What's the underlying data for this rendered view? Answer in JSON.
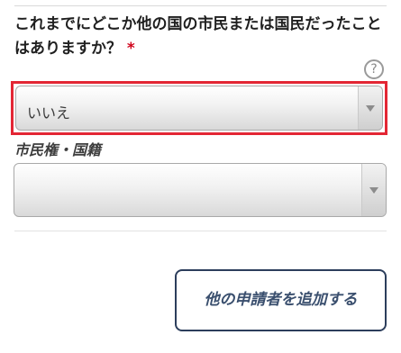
{
  "question": {
    "text": "これまでにどこか他の国の市民または国民だったことはありますか？",
    "required_marker": "*"
  },
  "help": {
    "symbol": "?",
    "icon": "help-circle-icon"
  },
  "former_citizen_select": {
    "value": "いいえ",
    "icon": "dropdown-arrow-icon"
  },
  "citizenship_field": {
    "label": "市民権・国籍",
    "value": "",
    "icon": "dropdown-arrow-icon"
  },
  "add_applicant_button": {
    "label": "他の申請者を追加する"
  },
  "colors": {
    "highlight_border": "#e32634",
    "required": "#d0021b",
    "button_border": "#2c3e5c",
    "button_text": "#3a4f6e"
  }
}
